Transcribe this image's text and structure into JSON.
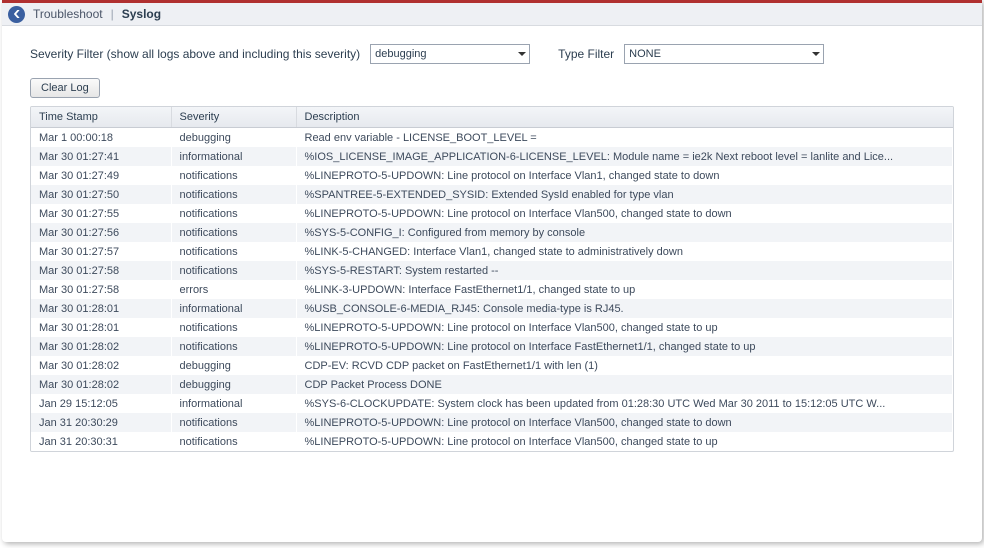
{
  "breadcrumb": {
    "parent": "Troubleshoot",
    "current": "Syslog"
  },
  "filters": {
    "severity_label": "Severity Filter (show all logs above and including this severity)",
    "severity_value": "debugging",
    "type_label": "Type Filter",
    "type_value": "NONE"
  },
  "buttons": {
    "clear_log": "Clear Log"
  },
  "columns": {
    "timestamp": "Time Stamp",
    "severity": "Severity",
    "description": "Description"
  },
  "rows": [
    {
      "ts": "Mar 1 00:00:18",
      "sev": "debugging",
      "desc": "Read env variable - LICENSE_BOOT_LEVEL ="
    },
    {
      "ts": "Mar 30 01:27:41",
      "sev": "informational",
      "desc": "%IOS_LICENSE_IMAGE_APPLICATION-6-LICENSE_LEVEL: Module name = ie2k Next reboot level = lanlite and Lice..."
    },
    {
      "ts": "Mar 30 01:27:49",
      "sev": "notifications",
      "desc": "%LINEPROTO-5-UPDOWN: Line protocol on Interface Vlan1, changed state to down"
    },
    {
      "ts": "Mar 30 01:27:50",
      "sev": "notifications",
      "desc": "%SPANTREE-5-EXTENDED_SYSID: Extended SysId enabled for type vlan"
    },
    {
      "ts": "Mar 30 01:27:55",
      "sev": "notifications",
      "desc": "%LINEPROTO-5-UPDOWN: Line protocol on Interface Vlan500, changed state to down"
    },
    {
      "ts": "Mar 30 01:27:56",
      "sev": "notifications",
      "desc": "%SYS-5-CONFIG_I: Configured from memory by console"
    },
    {
      "ts": "Mar 30 01:27:57",
      "sev": "notifications",
      "desc": "%LINK-5-CHANGED: Interface Vlan1, changed state to administratively down"
    },
    {
      "ts": "Mar 30 01:27:58",
      "sev": "notifications",
      "desc": "%SYS-5-RESTART: System restarted --"
    },
    {
      "ts": "Mar 30 01:27:58",
      "sev": "errors",
      "desc": "%LINK-3-UPDOWN: Interface FastEthernet1/1, changed state to up"
    },
    {
      "ts": "Mar 30 01:28:01",
      "sev": "informational",
      "desc": "%USB_CONSOLE-6-MEDIA_RJ45: Console media-type is RJ45."
    },
    {
      "ts": "Mar 30 01:28:01",
      "sev": "notifications",
      "desc": "%LINEPROTO-5-UPDOWN: Line protocol on Interface Vlan500, changed state to up"
    },
    {
      "ts": "Mar 30 01:28:02",
      "sev": "notifications",
      "desc": "%LINEPROTO-5-UPDOWN: Line protocol on Interface FastEthernet1/1, changed state to up"
    },
    {
      "ts": "Mar 30 01:28:02",
      "sev": "debugging",
      "desc": "CDP-EV: RCVD CDP packet on FastEthernet1/1 with len (1)"
    },
    {
      "ts": "Mar 30 01:28:02",
      "sev": "debugging",
      "desc": "CDP Packet Process DONE"
    },
    {
      "ts": "Jan 29 15:12:05",
      "sev": "informational",
      "desc": "%SYS-6-CLOCKUPDATE: System clock has been updated from 01:28:30 UTC Wed Mar 30 2011 to 15:12:05 UTC W..."
    },
    {
      "ts": "Jan 31 20:30:29",
      "sev": "notifications",
      "desc": "%LINEPROTO-5-UPDOWN: Line protocol on Interface Vlan500, changed state to down"
    },
    {
      "ts": "Jan 31 20:30:31",
      "sev": "notifications",
      "desc": "%LINEPROTO-5-UPDOWN: Line protocol on Interface Vlan500, changed state to up"
    }
  ]
}
